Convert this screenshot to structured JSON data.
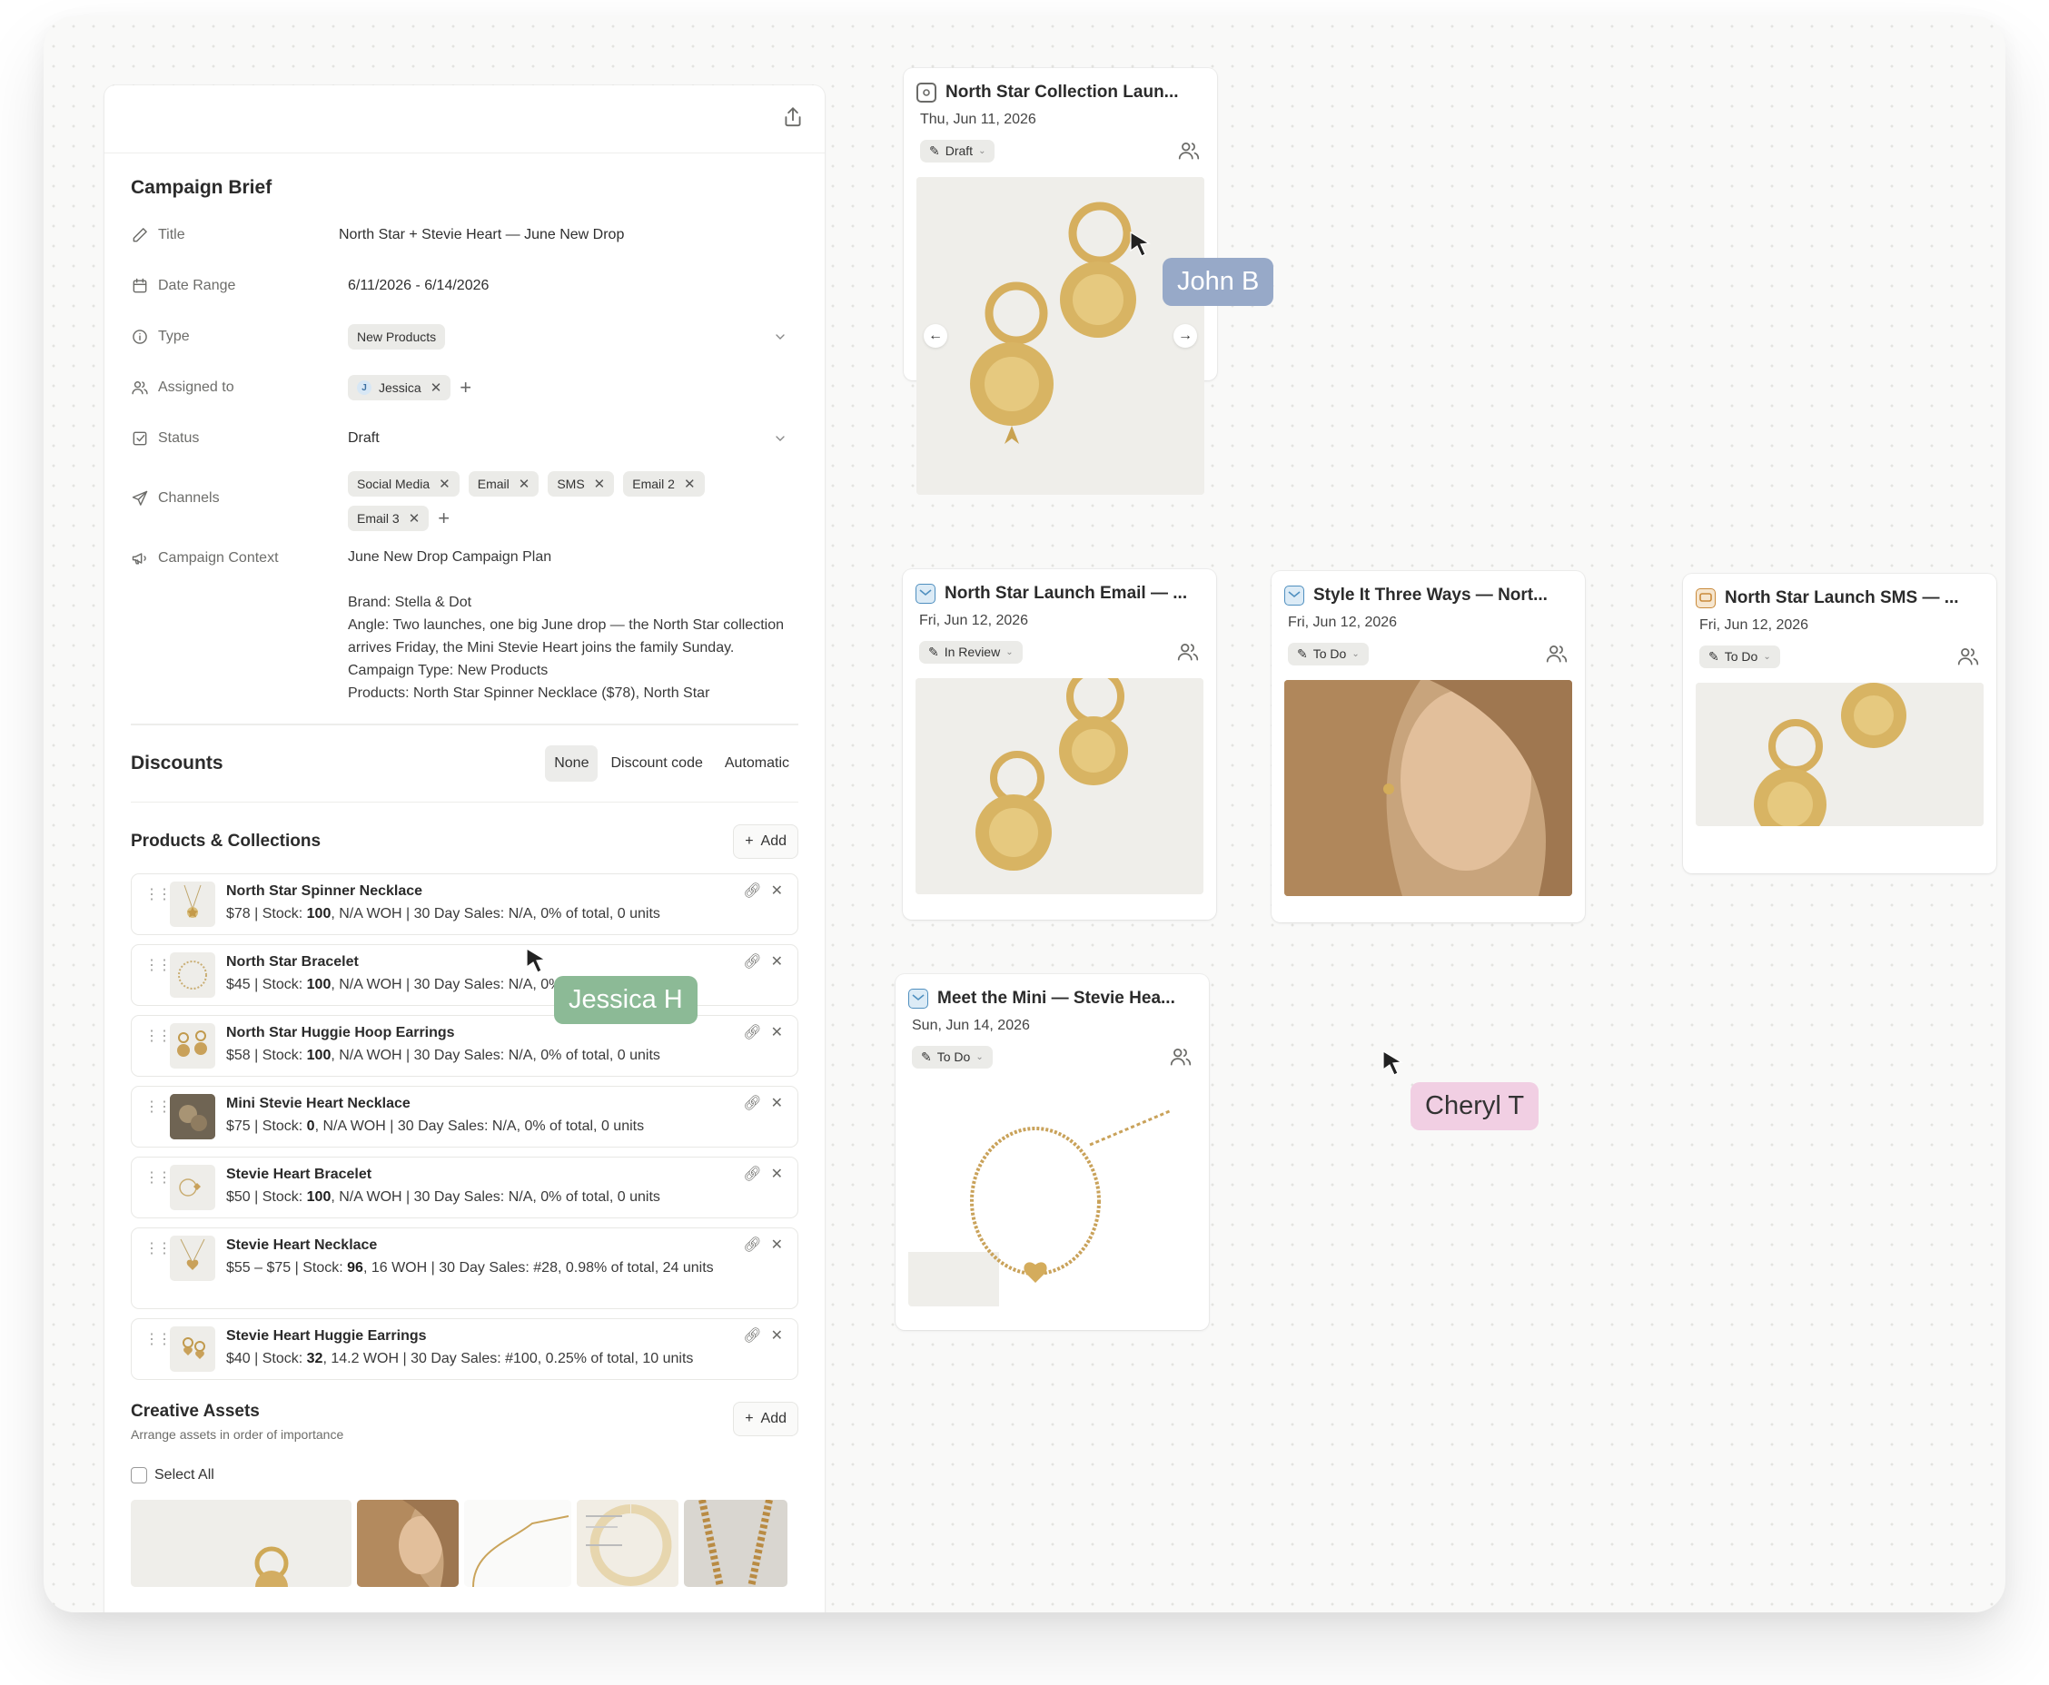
{
  "brief": {
    "heading": "Campaign Brief",
    "fields": {
      "title_label": "Title",
      "title_value": "North Star + Stevie Heart — June New Drop",
      "date_label": "Date Range",
      "date_value": "6/11/2026 - 6/14/2026",
      "type_label": "Type",
      "type_value": "New Products",
      "assigned_label": "Assigned to",
      "assigned_initial": "J",
      "assigned_value": "Jessica",
      "status_label": "Status",
      "status_value": "Draft",
      "channels_label": "Channels",
      "channels": [
        "Social Media",
        "Email",
        "SMS",
        "Email 2",
        "Email 3"
      ],
      "context_label": "Campaign Context",
      "context_lines": [
        "June New Drop Campaign Plan",
        "",
        "Brand: Stella & Dot",
        "Angle: Two launches, one big June drop — the North Star collection arrives Friday, the Mini Stevie Heart joins the family Sunday.",
        "Campaign Type: New Products",
        "Products: North Star Spinner Necklace ($78), North Star"
      ]
    }
  },
  "discounts": {
    "title": "Discounts",
    "options": [
      "None",
      "Discount code",
      "Automatic"
    ],
    "selected": "None"
  },
  "products": {
    "title": "Products & Collections",
    "add_label": "Add",
    "items": [
      {
        "name": "North Star Spinner Necklace",
        "price": "$78 | Stock: ",
        "stock": "100",
        "rest": ", N/A WOH | 30 Day Sales: N/A, 0% of total, 0 units"
      },
      {
        "name": "North Star Bracelet",
        "price": "$45 | Stock: ",
        "stock": "100",
        "rest": ", N/A WOH | 30 Day Sales: N/A, 0% of total, 0 units"
      },
      {
        "name": "North Star Huggie Hoop Earrings",
        "price": "$58 | Stock: ",
        "stock": "100",
        "rest": ", N/A WOH | 30 Day Sales: N/A, 0% of total, 0 units"
      },
      {
        "name": "Mini Stevie Heart Necklace",
        "price": "$75 | Stock: ",
        "stock": "0",
        "rest": ", N/A WOH | 30 Day Sales: N/A, 0% of total, 0 units"
      },
      {
        "name": "Stevie Heart Bracelet",
        "price": "$50 | Stock: ",
        "stock": "100",
        "rest": ", N/A WOH | 30 Day Sales: N/A, 0% of total, 0 units"
      },
      {
        "name": "Stevie Heart Necklace",
        "price": "$55 – $75 | Stock: ",
        "stock": "96",
        "rest": ", 16 WOH | 30 Day Sales: #28, 0.98% of total, 24 units"
      },
      {
        "name": "Stevie Heart Huggie Earrings",
        "price": "$40 | Stock: ",
        "stock": "32",
        "rest": ", 14.2 WOH | 30 Day Sales: #100, 0.25% of total, 10 units"
      }
    ]
  },
  "creative": {
    "title": "Creative Assets",
    "subtitle": "Arrange assets in order of importance",
    "add_label": "Add",
    "select_all": "Select All"
  },
  "cards": [
    {
      "title": "North Star Collection Laun...",
      "date": "Thu, Jun 11, 2026",
      "status": "Draft",
      "channel_icon": "instagram-icon",
      "icon_color": "#6b6b68"
    },
    {
      "title": "North Star Launch Email — ...",
      "date": "Fri, Jun 12, 2026",
      "status": "In Review",
      "channel_icon": "email-icon",
      "icon_color": "#4f8fbf"
    },
    {
      "title": "Style It Three Ways — Nort...",
      "date": "Fri, Jun 12, 2026",
      "status": "To Do",
      "channel_icon": "email-icon",
      "icon_color": "#4f8fbf"
    },
    {
      "title": "North Star Launch SMS — ...",
      "date": "Fri, Jun 12, 2026",
      "status": "To Do",
      "channel_icon": "sms-icon",
      "icon_color": "#c98a3a"
    },
    {
      "title": "Meet the Mini — Stevie Hea...",
      "date": "Sun, Jun 14, 2026",
      "status": "To Do",
      "channel_icon": "email-icon",
      "icon_color": "#4f8fbf"
    }
  ],
  "cursors": [
    {
      "name": "John B",
      "color": "#97a9c8"
    },
    {
      "name": "Jessica H",
      "color": "#8cba96"
    },
    {
      "name": "Cheryl T",
      "color": "#f1cfe3"
    }
  ]
}
